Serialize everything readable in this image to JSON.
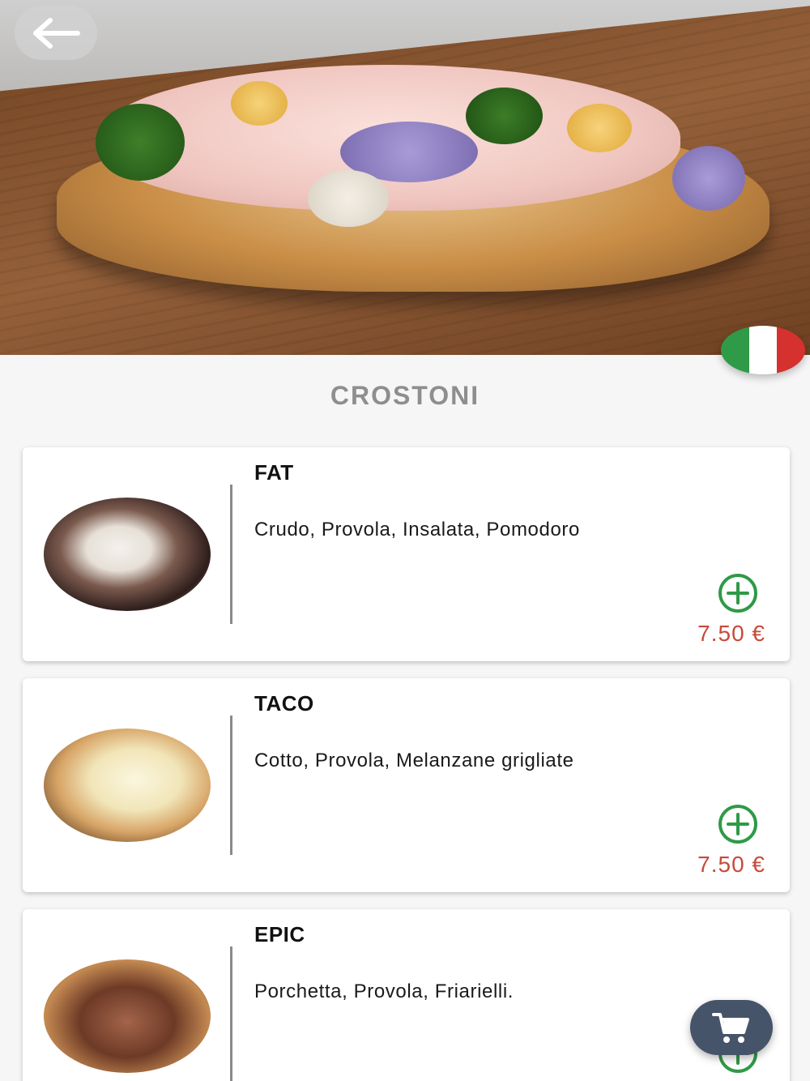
{
  "header": {
    "back_icon": "arrow-left-icon",
    "language_flag": {
      "icon": "italy-flag-icon",
      "colors": [
        "#2f9a47",
        "#ffffff",
        "#d5312f"
      ]
    }
  },
  "section": {
    "title": "CROSTONI"
  },
  "products": [
    {
      "name": "FAT",
      "description": "Crudo, Provola, Insalata, Pomodoro",
      "price": "7.50 €",
      "add_icon": "plus-circle-icon"
    },
    {
      "name": "TACO",
      "description": "Cotto, Provola, Melanzane grigliate",
      "price": "7.50 €",
      "add_icon": "plus-circle-icon"
    },
    {
      "name": "EPIC",
      "description": "Porchetta, Provola, Friarielli.",
      "add_icon": "plus-circle-icon"
    }
  ],
  "cart": {
    "icon": "shopping-cart-icon"
  },
  "colors": {
    "price": "#c84a3a",
    "add_icon": "#2f9a47",
    "cart_button": "#46546a"
  }
}
